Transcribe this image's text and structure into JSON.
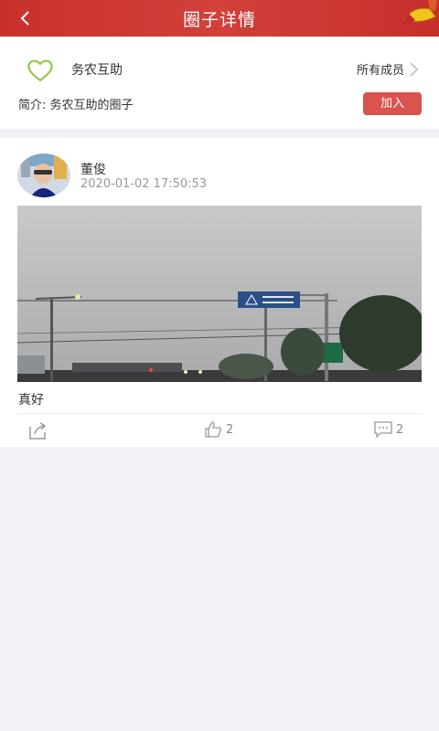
{
  "header": {
    "title": "圈子详情",
    "back_icon": "chevron-left-icon",
    "decoration_icon": "ribbon-decoration-icon"
  },
  "circle": {
    "name": "务农互助",
    "icon": "heart-outline-icon",
    "members_link": "所有成员",
    "intro": "简介: 务农互助的圈子",
    "join_label": "加入"
  },
  "post": {
    "author": "董俊",
    "time": "2020-01-02 17:50:53",
    "text": "真好",
    "likes": "2",
    "comments": "2"
  },
  "colors": {
    "header": "#c9302c",
    "join_button": "#d9534f",
    "heart": "#8cc43e",
    "background": "#f2f2f6"
  }
}
